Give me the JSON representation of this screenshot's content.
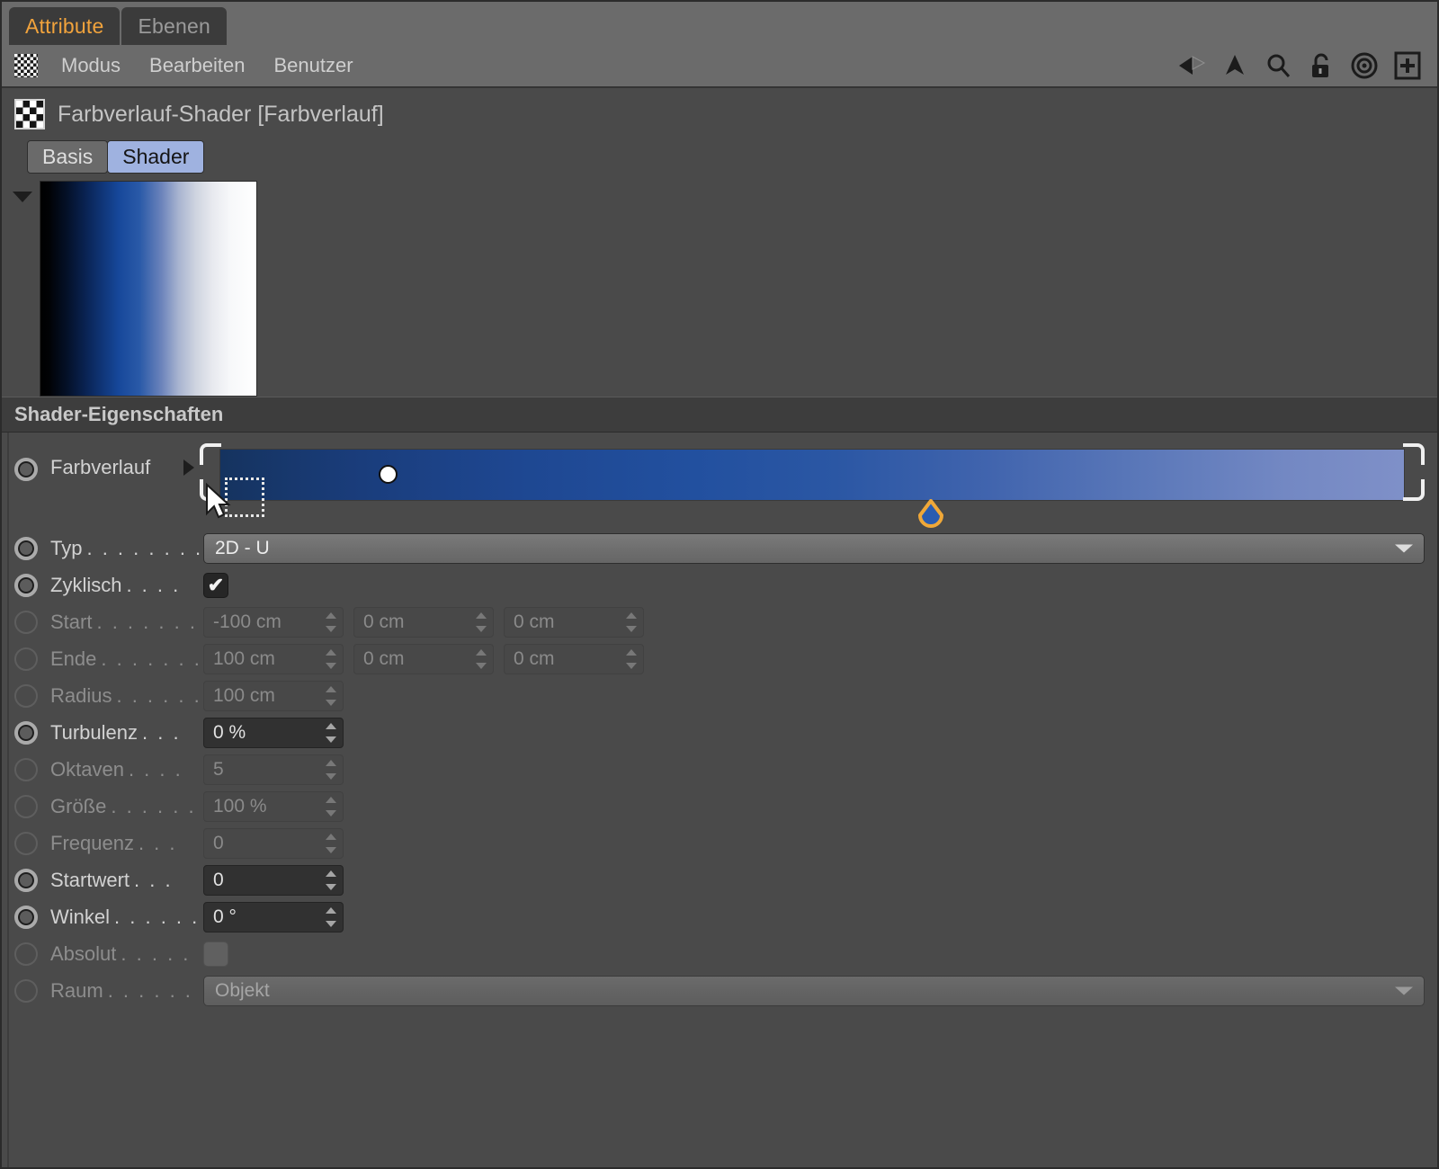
{
  "window": {
    "tabs": [
      {
        "label": "Attribute",
        "active": true
      },
      {
        "label": "Ebenen",
        "active": false
      }
    ],
    "accent_active_tab": "#f1a33c"
  },
  "menubar": {
    "icon": "checkerboard-icon",
    "items": [
      "Modus",
      "Bearbeiten",
      "Benutzer"
    ],
    "tools": [
      "back-arrow-icon",
      "up-arrow-icon",
      "search-icon",
      "unlock-icon",
      "target-icon",
      "add-box-icon"
    ]
  },
  "object": {
    "icon": "checkerboard-shader-icon",
    "title": "Farbverlauf-Shader [Farbverlauf]",
    "tab_buttons": [
      {
        "label": "Basis",
        "active": false
      },
      {
        "label": "Shader",
        "active": true
      }
    ]
  },
  "preview": {
    "collapse_icon": "triangle-down-icon",
    "gradient_stops": [
      "#000000",
      "#0a2558",
      "#16479a",
      "#6b83bb",
      "#cfd4e0",
      "#ffffff"
    ]
  },
  "section": {
    "title": "Shader-Eigenschaften"
  },
  "gradient_row": {
    "label": "Farbverlauf",
    "expand_icon": "triangle-right-icon",
    "enabled": true,
    "bar_stops": [
      "#15335f",
      "#1e4791",
      "#2b57a4",
      "#5b78b9",
      "#7f90c8"
    ],
    "knot_dot_position_pct": 14,
    "knot_pin_position_pct": 60,
    "knot_pin_outline_color": "#f0a838",
    "knot_pin_fill_color": "#2a5cb0",
    "cursor": "arrow-marquee-cursor"
  },
  "rows": [
    {
      "name": "typ",
      "label": "Typ",
      "dots": ". . . . . . . .",
      "enabled": true,
      "control": "dropdown",
      "value": "2D - U"
    },
    {
      "name": "zyklisch",
      "label": "Zyklisch",
      "dots": ". . . .",
      "enabled": true,
      "control": "checkbox",
      "checked": true,
      "tick": "✔"
    },
    {
      "name": "start",
      "label": "Start",
      "dots": ". . . . . . .",
      "enabled": false,
      "control": "vector3",
      "values": [
        "-100 cm",
        "0 cm",
        "0 cm"
      ]
    },
    {
      "name": "ende",
      "label": "Ende",
      "dots": ". . . . . . .",
      "enabled": false,
      "control": "vector3",
      "values": [
        "100 cm",
        "0 cm",
        "0 cm"
      ]
    },
    {
      "name": "radius",
      "label": "Radius",
      "dots": ". . . . . .",
      "enabled": false,
      "control": "number",
      "value": "100 cm"
    },
    {
      "name": "turbulenz",
      "label": "Turbulenz",
      "dots": ". . .",
      "enabled": true,
      "control": "number",
      "value": "0 %"
    },
    {
      "name": "oktaven",
      "label": "Oktaven",
      "dots": ". . . .",
      "enabled": false,
      "control": "number",
      "value": "5"
    },
    {
      "name": "groesse",
      "label": "Größe",
      "dots": ". . . . . .",
      "enabled": false,
      "control": "number",
      "value": "100 %"
    },
    {
      "name": "frequenz",
      "label": "Frequenz",
      "dots": ". . .",
      "enabled": false,
      "control": "number",
      "value": "0"
    },
    {
      "name": "startwert",
      "label": "Startwert",
      "dots": ". . .",
      "enabled": true,
      "control": "number",
      "value": "0"
    },
    {
      "name": "winkel",
      "label": "Winkel",
      "dots": ". . . . . .",
      "enabled": true,
      "control": "number",
      "value": "0 °"
    },
    {
      "name": "absolut",
      "label": "Absolut",
      "dots": ". . . . .",
      "enabled": false,
      "control": "checkbox",
      "checked": false,
      "tick": ""
    },
    {
      "name": "raum",
      "label": "Raum",
      "dots": ". . . . . .",
      "enabled": false,
      "control": "dropdown",
      "value": "Objekt"
    }
  ]
}
